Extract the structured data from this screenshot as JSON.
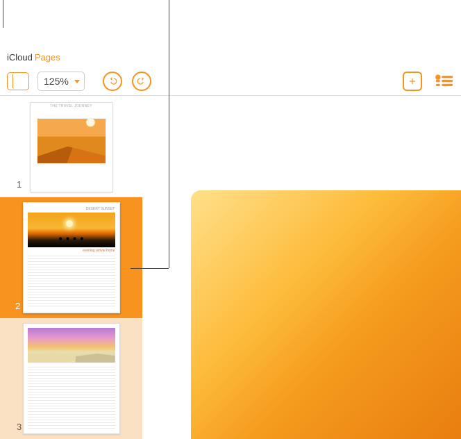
{
  "header": {
    "cloud": "iCloud",
    "app": "Pages"
  },
  "toolbar": {
    "zoom_value": "125%"
  },
  "sidebar": {
    "pages": [
      {
        "num": "1"
      },
      {
        "num": "2"
      },
      {
        "num": "3"
      }
    ]
  }
}
